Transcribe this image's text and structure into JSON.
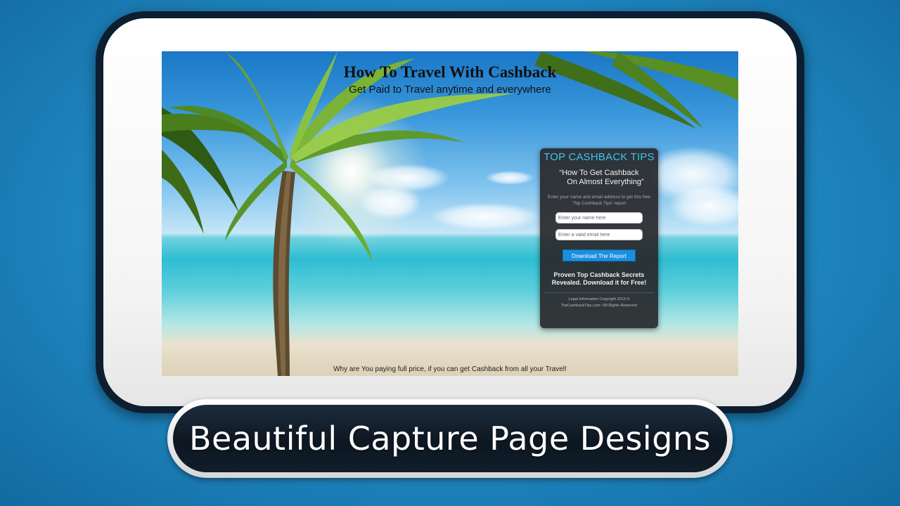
{
  "page": {
    "title": "How To Travel With Cashback",
    "subtitle": "Get Paid to Travel anytime and everywhere",
    "footer": "Why are You paying full price, if you can get Cashback from all your Travel!"
  },
  "optin": {
    "heading": "TOP CASHBACK TIPS",
    "hook_line1": "“How To Get Cashback",
    "hook_line2": "On Almost Everything”",
    "instructions": "Enter your name and email address to get this free 'Top Cashback Tips' report",
    "name_placeholder": "Enter your name here",
    "email_placeholder": "Enter a valid email here",
    "button_label": "Download The Report",
    "promo_line1": "Proven Top Cashback Secrets",
    "promo_line2": "Revealed. Download it for Free!",
    "legal_line1": "Legal Information Copyright 2013 ©",
    "legal_line2": "TopCashbackTips.com / All Rights Reserved"
  },
  "banner": {
    "text": "Beautiful Capture Page Designs"
  },
  "colors": {
    "accent": "#3cc5ee",
    "button": "#1a8fe0",
    "background": "#1f86bf"
  }
}
